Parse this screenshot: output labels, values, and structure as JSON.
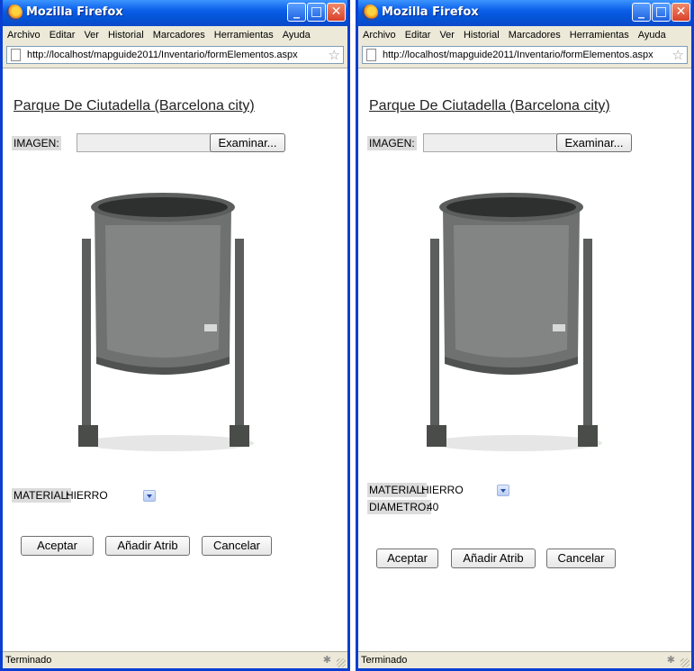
{
  "windows": [
    {
      "title": "Mozilla Firefox",
      "menu": [
        "Archivo",
        "Editar",
        "Ver",
        "Historial",
        "Marcadores",
        "Herramientas",
        "Ayuda"
      ],
      "url": "http://localhost/mapguide2011/Inventario/formElementos.aspx",
      "page_title": "Parque De Ciutadella (Barcelona  city)",
      "imagen_label": "IMAGEN:",
      "browse_button": "Examinar...",
      "material_label": "MATERIAL:",
      "material_value": "HIERRO",
      "buttons": {
        "accept": "Aceptar",
        "add_attr": "Añadir Atrib",
        "cancel": "Cancelar"
      },
      "status": "Terminado"
    },
    {
      "title": "Mozilla Firefox",
      "menu": [
        "Archivo",
        "Editar",
        "Ver",
        "Historial",
        "Marcadores",
        "Herramientas",
        "Ayuda"
      ],
      "url": "http://localhost/mapguide2011/Inventario/formElementos.aspx",
      "page_title": "Parque De Ciutadella (Barcelona  city)",
      "imagen_label": "IMAGEN:",
      "browse_button": "Examinar...",
      "material_label": "MATERIAL:",
      "material_value": "HIERRO",
      "diametro_label": "DIAMETRO:",
      "diametro_value": "40",
      "buttons": {
        "accept": "Aceptar",
        "add_attr": "Añadir Atrib",
        "cancel": "Cancelar"
      },
      "status": "Terminado"
    }
  ],
  "colors": {
    "titlebar": "#0a5ee8",
    "chrome": "#ece9d8",
    "frame": "#0b3fd1",
    "close": "#d8402a"
  },
  "icons": [
    "firefox-icon",
    "minimize-icon",
    "maximize-icon",
    "close-icon",
    "page-icon",
    "bookmark-star-icon",
    "dropdown-arrow-icon",
    "network-activity-icon",
    "resize-grip-icon"
  ]
}
